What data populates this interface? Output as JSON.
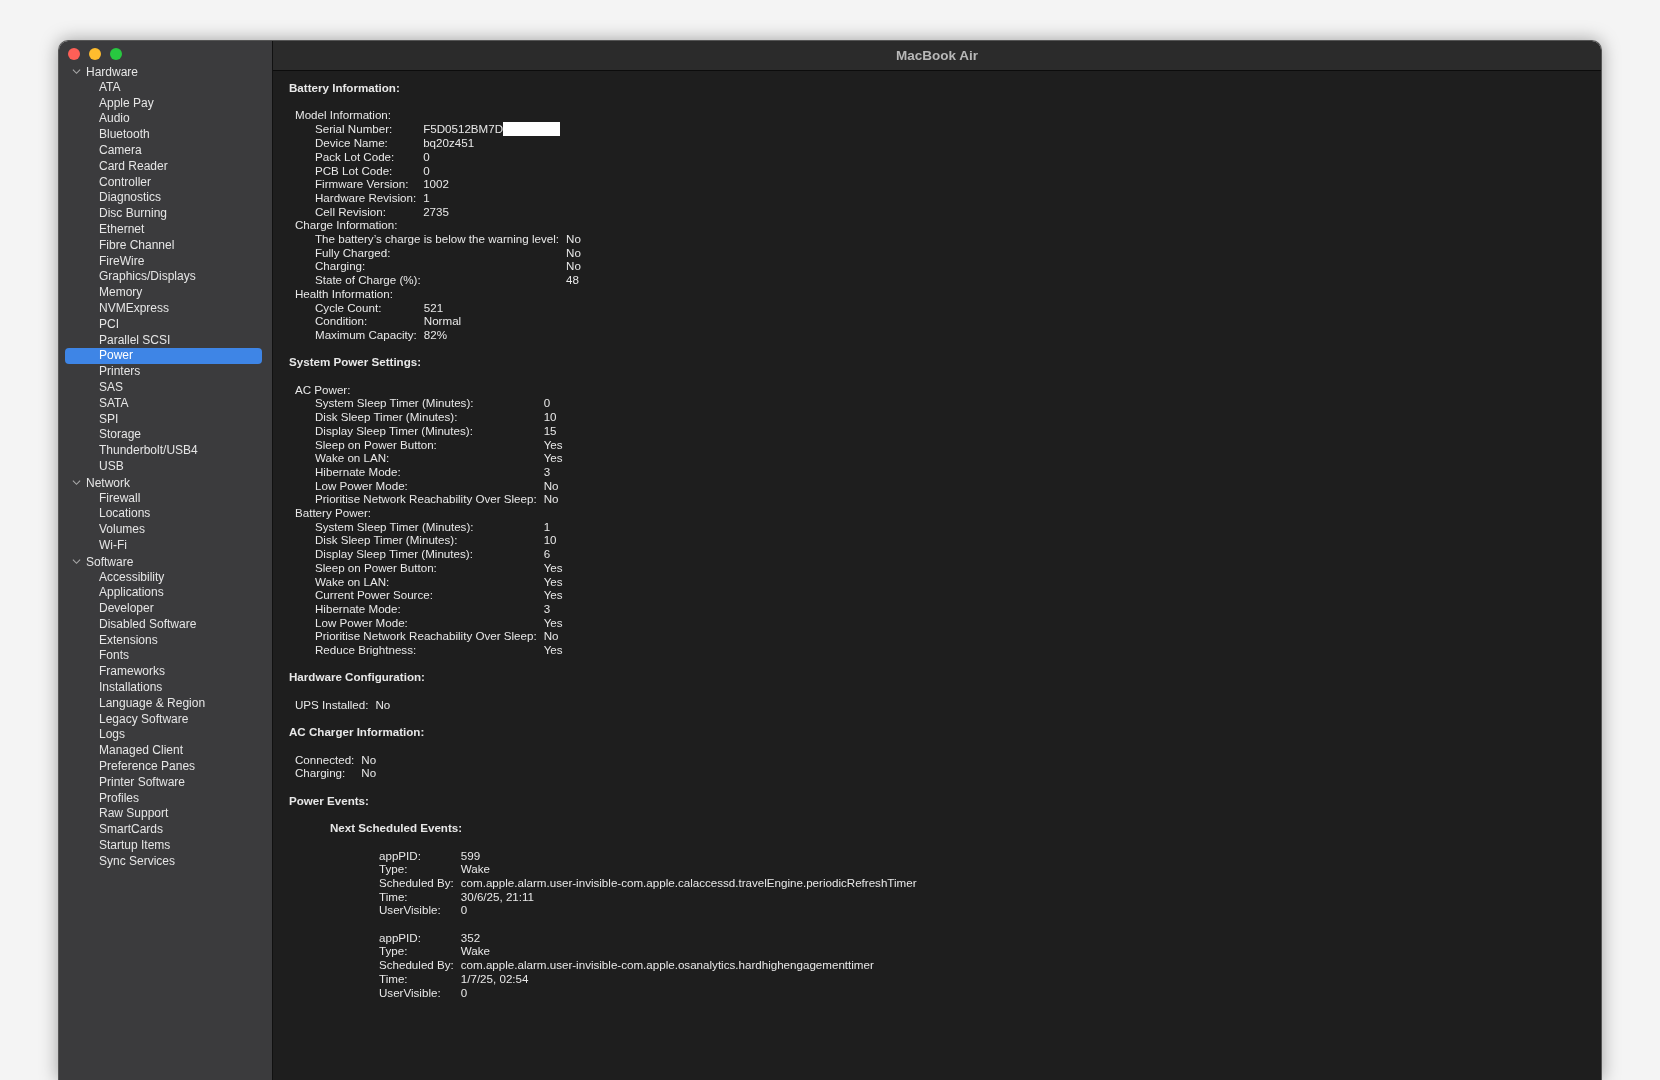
{
  "window": {
    "title": "MacBook Air"
  },
  "sidebar": {
    "groups": [
      {
        "label": "Hardware",
        "expanded": true,
        "children": [
          {
            "label": "ATA",
            "selected": false
          },
          {
            "label": "Apple Pay",
            "selected": false
          },
          {
            "label": "Audio",
            "selected": false
          },
          {
            "label": "Bluetooth",
            "selected": false
          },
          {
            "label": "Camera",
            "selected": false
          },
          {
            "label": "Card Reader",
            "selected": false
          },
          {
            "label": "Controller",
            "selected": false
          },
          {
            "label": "Diagnostics",
            "selected": false
          },
          {
            "label": "Disc Burning",
            "selected": false
          },
          {
            "label": "Ethernet",
            "selected": false
          },
          {
            "label": "Fibre Channel",
            "selected": false
          },
          {
            "label": "FireWire",
            "selected": false
          },
          {
            "label": "Graphics/Displays",
            "selected": false
          },
          {
            "label": "Memory",
            "selected": false
          },
          {
            "label": "NVMExpress",
            "selected": false
          },
          {
            "label": "PCI",
            "selected": false
          },
          {
            "label": "Parallel SCSI",
            "selected": false
          },
          {
            "label": "Power",
            "selected": true
          },
          {
            "label": "Printers",
            "selected": false
          },
          {
            "label": "SAS",
            "selected": false
          },
          {
            "label": "SATA",
            "selected": false
          },
          {
            "label": "SPI",
            "selected": false
          },
          {
            "label": "Storage",
            "selected": false
          },
          {
            "label": "Thunderbolt/USB4",
            "selected": false
          },
          {
            "label": "USB",
            "selected": false
          }
        ]
      },
      {
        "label": "Network",
        "expanded": true,
        "children": [
          {
            "label": "Firewall",
            "selected": false
          },
          {
            "label": "Locations",
            "selected": false
          },
          {
            "label": "Volumes",
            "selected": false
          },
          {
            "label": "Wi-Fi",
            "selected": false
          }
        ]
      },
      {
        "label": "Software",
        "expanded": true,
        "children": [
          {
            "label": "Accessibility",
            "selected": false
          },
          {
            "label": "Applications",
            "selected": false
          },
          {
            "label": "Developer",
            "selected": false
          },
          {
            "label": "Disabled Software",
            "selected": false
          },
          {
            "label": "Extensions",
            "selected": false
          },
          {
            "label": "Fonts",
            "selected": false
          },
          {
            "label": "Frameworks",
            "selected": false
          },
          {
            "label": "Installations",
            "selected": false
          },
          {
            "label": "Language & Region",
            "selected": false
          },
          {
            "label": "Legacy Software",
            "selected": false
          },
          {
            "label": "Logs",
            "selected": false
          },
          {
            "label": "Managed Client",
            "selected": false
          },
          {
            "label": "Preference Panes",
            "selected": false
          },
          {
            "label": "Printer Software",
            "selected": false
          },
          {
            "label": "Profiles",
            "selected": false
          },
          {
            "label": "Raw Support",
            "selected": false
          },
          {
            "label": "SmartCards",
            "selected": false
          },
          {
            "label": "Startup Items",
            "selected": false
          },
          {
            "label": "Sync Services",
            "selected": false
          }
        ]
      }
    ]
  },
  "report": {
    "sections": [
      {
        "kind": "grouped",
        "title": "Battery Information:",
        "groups": [
          {
            "label": "Model Information:",
            "rows": [
              {
                "label": "Serial Number:",
                "value": "F5D0512BM7D",
                "redacted": true
              },
              {
                "label": "Device Name:",
                "value": "bq20z451"
              },
              {
                "label": "Pack Lot Code:",
                "value": "0"
              },
              {
                "label": "PCB Lot Code:",
                "value": "0"
              },
              {
                "label": "Firmware Version:",
                "value": "1002"
              },
              {
                "label": "Hardware Revision:",
                "value": "1"
              },
              {
                "label": "Cell Revision:",
                "value": "2735"
              }
            ]
          },
          {
            "label": "Charge Information:",
            "rows": [
              {
                "label": "The battery’s charge is below the warning level:",
                "value": "No"
              },
              {
                "label": "Fully Charged:",
                "value": "No"
              },
              {
                "label": "Charging:",
                "value": "No"
              },
              {
                "label": "State of Charge (%):",
                "value": "48"
              }
            ]
          },
          {
            "label": "Health Information:",
            "rows": [
              {
                "label": "Cycle Count:",
                "value": "521"
              },
              {
                "label": "Condition:",
                "value": "Normal"
              },
              {
                "label": "Maximum Capacity:",
                "value": "82%"
              }
            ]
          }
        ]
      },
      {
        "kind": "grouped",
        "title": "System Power Settings:",
        "groups": [
          {
            "label": "AC Power:",
            "rows": [
              {
                "label": "System Sleep Timer (Minutes):",
                "value": "0"
              },
              {
                "label": "Disk Sleep Timer (Minutes):",
                "value": "10"
              },
              {
                "label": "Display Sleep Timer (Minutes):",
                "value": "15"
              },
              {
                "label": "Sleep on Power Button:",
                "value": "Yes"
              },
              {
                "label": "Wake on LAN:",
                "value": "Yes"
              },
              {
                "label": "Hibernate Mode:",
                "value": "3"
              },
              {
                "label": "Low Power Mode:",
                "value": "No"
              },
              {
                "label": "Prioritise Network Reachability Over Sleep:",
                "value": "No"
              }
            ]
          },
          {
            "label": "Battery Power:",
            "rows": [
              {
                "label": "System Sleep Timer (Minutes):",
                "value": "1"
              },
              {
                "label": "Disk Sleep Timer (Minutes):",
                "value": "10"
              },
              {
                "label": "Display Sleep Timer (Minutes):",
                "value": "6"
              },
              {
                "label": "Sleep on Power Button:",
                "value": "Yes"
              },
              {
                "label": "Wake on LAN:",
                "value": "Yes"
              },
              {
                "label": "Current Power Source:",
                "value": "Yes"
              },
              {
                "label": "Hibernate Mode:",
                "value": "3"
              },
              {
                "label": "Low Power Mode:",
                "value": "Yes"
              },
              {
                "label": "Prioritise Network Reachability Over Sleep:",
                "value": "No"
              },
              {
                "label": "Reduce Brightness:",
                "value": "Yes"
              }
            ]
          }
        ]
      },
      {
        "kind": "flat",
        "title": "Hardware Configuration:",
        "rows": [
          {
            "label": "UPS Installed:",
            "value": "No"
          }
        ]
      },
      {
        "kind": "flat",
        "title": "AC Charger Information:",
        "rows": [
          {
            "label": "Connected:",
            "value": "No"
          },
          {
            "label": "Charging:",
            "value": "No"
          }
        ]
      },
      {
        "kind": "events",
        "title": "Power Events:",
        "subtitle": "Next Scheduled Events:",
        "events": [
          [
            {
              "label": "appPID:",
              "value": "599"
            },
            {
              "label": "Type:",
              "value": "Wake"
            },
            {
              "label": "Scheduled By:",
              "value": "com.apple.alarm.user-invisible-com.apple.calaccessd.travelEngine.periodicRefreshTimer"
            },
            {
              "label": "Time:",
              "value": "30/6/25, 21:11"
            },
            {
              "label": "UserVisible:",
              "value": "0"
            }
          ],
          [
            {
              "label": "appPID:",
              "value": "352"
            },
            {
              "label": "Type:",
              "value": "Wake"
            },
            {
              "label": "Scheduled By:",
              "value": "com.apple.alarm.user-invisible-com.apple.osanalytics.hardhighengagementtimer"
            },
            {
              "label": "Time:",
              "value": "1/7/25, 02:54"
            },
            {
              "label": "UserVisible:",
              "value": "0"
            }
          ]
        ]
      }
    ]
  }
}
